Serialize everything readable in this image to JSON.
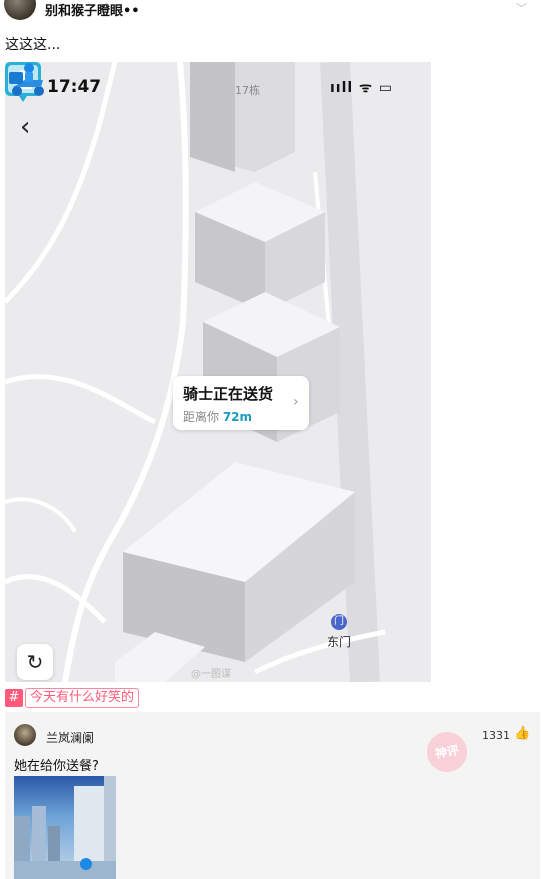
{
  "post": {
    "username": "别和猴子瞪眼••",
    "text": "这这这..."
  },
  "map_screenshot": {
    "time": "17:47",
    "status_icons": "ııll ᯤ ▭",
    "building_label": "17栋",
    "callout_title": "骑士正在送货",
    "callout_sub_prefix": "距离你 ",
    "callout_distance": "72m",
    "gate_label": "东门",
    "gate_icon_text": "门",
    "watermark": "@一图谋"
  },
  "topic": {
    "label": "今天有什么好笑的"
  },
  "comment": {
    "username": "兰岚澜阑",
    "likes": "1331",
    "text": "她在给你送餐?",
    "stamp_text": "神评"
  },
  "colors": {
    "accent_teal": "#1a9bbf",
    "topic_pink": "#ff5a7a",
    "gate_blue": "#4a66c9"
  }
}
